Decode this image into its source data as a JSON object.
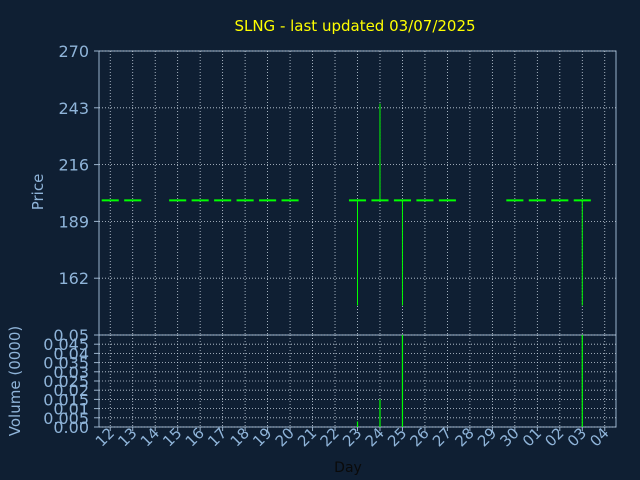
{
  "title": "SLNG - last updated 03/07/2025",
  "colors": {
    "background": "#0f1f33",
    "title": "#ffff00",
    "axis_text": "#8fb4d9",
    "frame": "#9ab3cc",
    "grid": "#c8d4e0",
    "data": "#00ff00",
    "x_label": "#0a0a0a"
  },
  "chart_data": [
    {
      "type": "ohlc",
      "title": "SLNG - last updated 03/07/2025",
      "ylabel": "Price",
      "ylim": [
        135,
        270
      ],
      "yticks": [
        162,
        189,
        216,
        243,
        270
      ],
      "grid": true,
      "days": [
        "12",
        "13",
        "14",
        "15",
        "16",
        "17",
        "18",
        "19",
        "20",
        "21",
        "22",
        "23",
        "24",
        "25",
        "26",
        "27",
        "28",
        "29",
        "30",
        "01",
        "02",
        "03",
        "04"
      ],
      "bars": [
        {
          "day": "12",
          "open": 199,
          "close": 199,
          "high": 199,
          "low": 199
        },
        {
          "day": "13",
          "open": 199,
          "close": 199,
          "high": 199,
          "low": 199
        },
        {
          "day": "15",
          "open": 199,
          "close": 199,
          "high": 199,
          "low": 199
        },
        {
          "day": "16",
          "open": 199,
          "close": 199,
          "high": 199,
          "low": 199
        },
        {
          "day": "17",
          "open": 199,
          "close": 199,
          "high": 199,
          "low": 199
        },
        {
          "day": "18",
          "open": 199,
          "close": 199,
          "high": 199,
          "low": 199
        },
        {
          "day": "19",
          "open": 199,
          "close": 199,
          "high": 199,
          "low": 199
        },
        {
          "day": "20",
          "open": 199,
          "close": 199,
          "high": 199,
          "low": 199
        },
        {
          "day": "23",
          "open": 199,
          "close": 199,
          "high": 199,
          "low": 149
        },
        {
          "day": "24",
          "open": 199,
          "close": 199,
          "high": 245,
          "low": 199
        },
        {
          "day": "25",
          "open": 199,
          "close": 199,
          "high": 199,
          "low": 149
        },
        {
          "day": "26",
          "open": 199,
          "close": 199,
          "high": 199,
          "low": 199
        },
        {
          "day": "27",
          "open": 199,
          "close": 199,
          "high": 199,
          "low": 199
        },
        {
          "day": "30",
          "open": 199,
          "close": 199,
          "high": 199,
          "low": 199
        },
        {
          "day": "01",
          "open": 199,
          "close": 199,
          "high": 199,
          "low": 199
        },
        {
          "day": "02",
          "open": 199,
          "close": 199,
          "high": 199,
          "low": 199
        },
        {
          "day": "03",
          "open": 199,
          "close": 199,
          "high": 199,
          "low": 149
        }
      ]
    },
    {
      "type": "bar",
      "ylabel": "Volume (0000)",
      "xlabel": "Day",
      "ylim": [
        0,
        0.05
      ],
      "yticks": [
        0,
        0.005,
        0.01,
        0.015,
        0.02,
        0.025,
        0.03,
        0.035,
        0.04,
        0.045,
        0.05
      ],
      "ytick_labels": [
        "0.00",
        "0.005",
        "0.01",
        "0.015",
        "0.02",
        "0.025",
        "0.03",
        "0.035",
        "0.04",
        "0.045",
        "0.05"
      ],
      "grid": true,
      "categories": [
        "23",
        "24",
        "25",
        "03"
      ],
      "values": [
        0.003,
        0.015,
        0.05,
        0.05
      ]
    }
  ]
}
